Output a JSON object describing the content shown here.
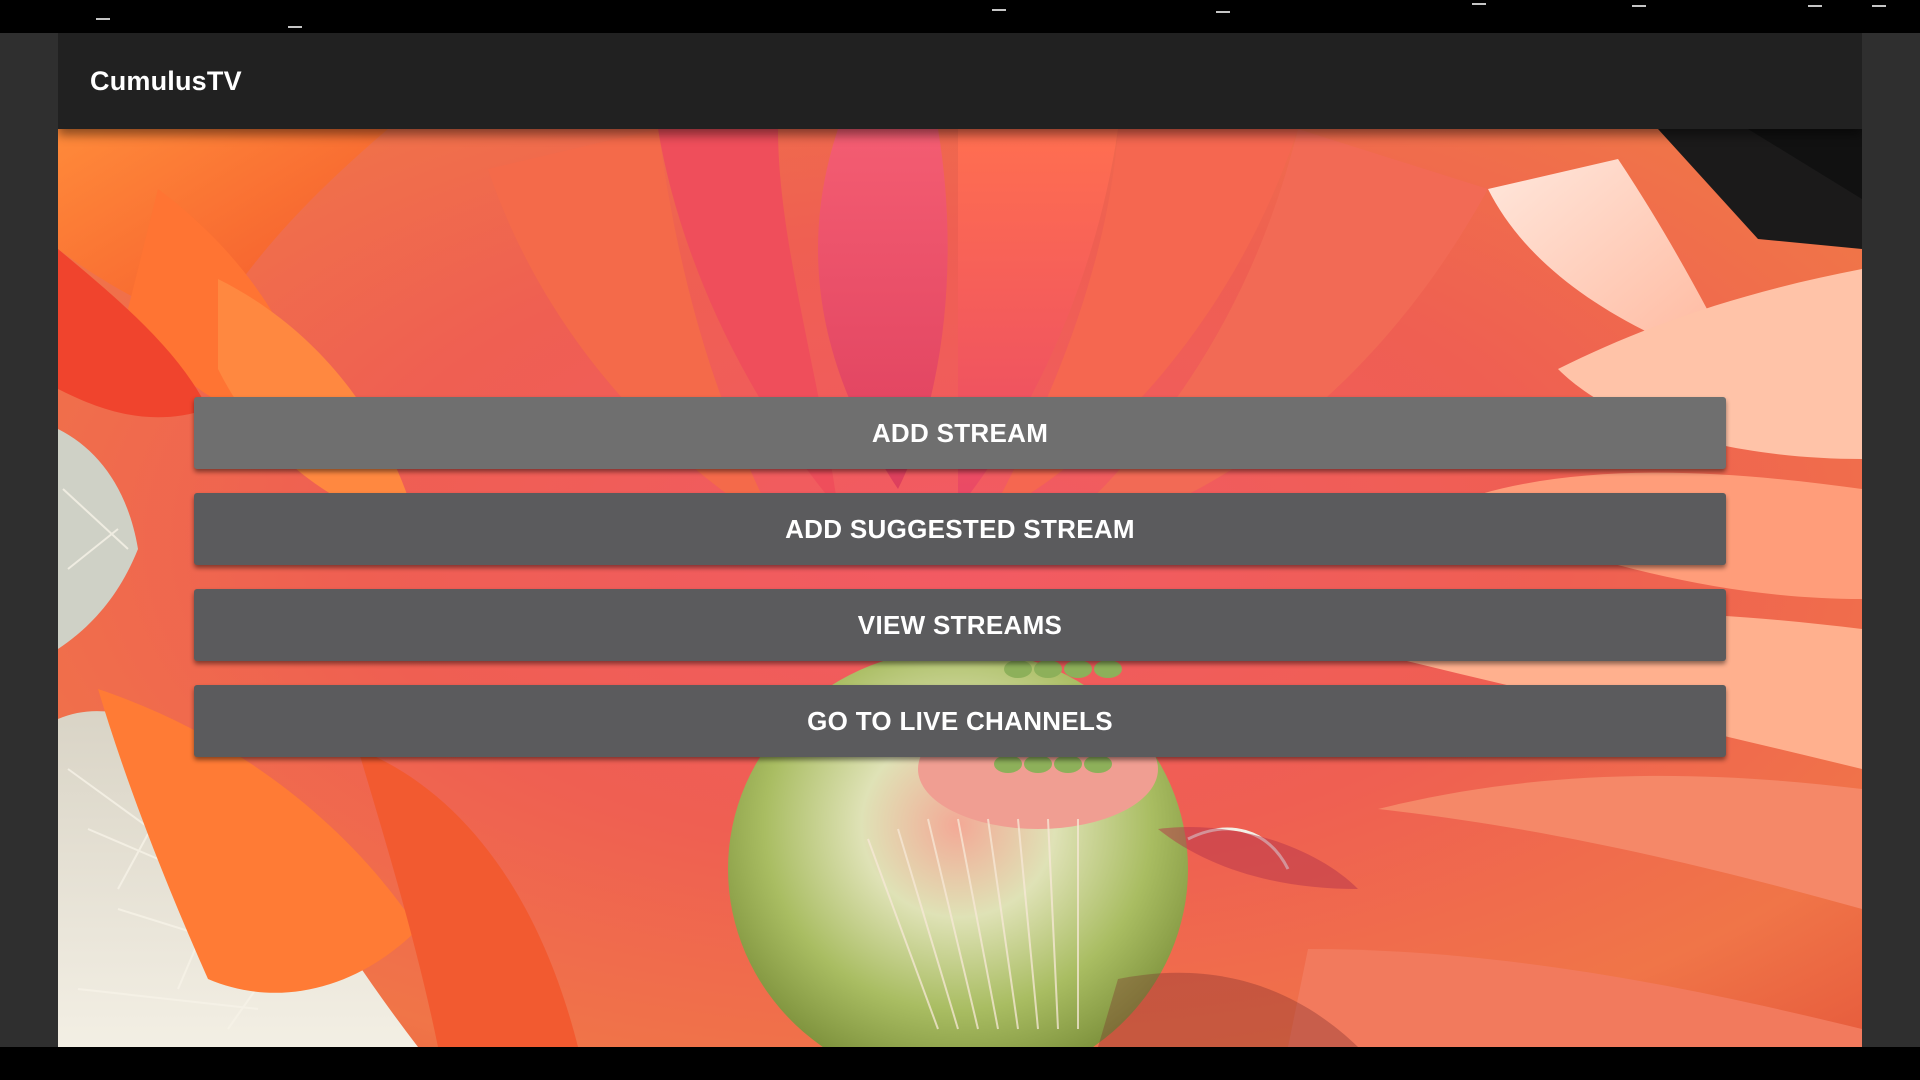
{
  "app": {
    "title": "CumulusTV"
  },
  "menu": {
    "buttons": [
      {
        "label": "ADD STREAM",
        "focused": true
      },
      {
        "label": "ADD SUGGESTED STREAM",
        "focused": false
      },
      {
        "label": "VIEW STREAMS",
        "focused": false
      },
      {
        "label": "GO TO LIVE CHANNELS",
        "focused": false
      }
    ]
  },
  "colors": {
    "toolbar": "#212121",
    "button_focused": "#6f6f6f",
    "button_normal": "#5b5b5d",
    "side_panel": "#2f2f2f",
    "text": "#ffffff"
  },
  "background": {
    "icon": "flower-photo"
  }
}
